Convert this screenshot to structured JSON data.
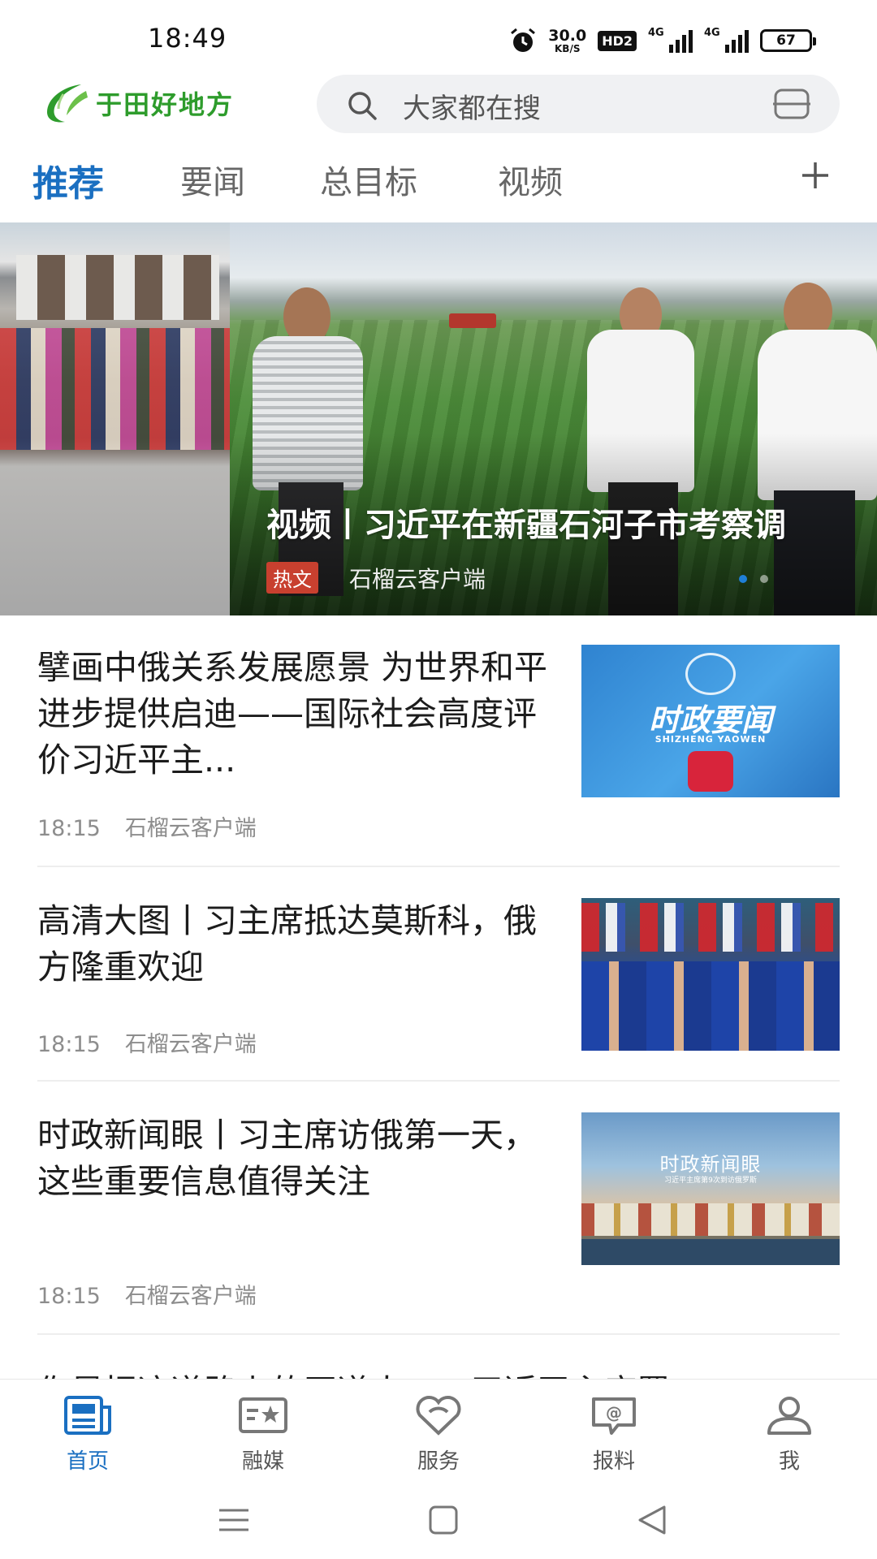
{
  "status_bar": {
    "time": "18:49",
    "speed_value": "30.0",
    "speed_unit": "KB/S",
    "hd_badge": "HD2",
    "network_1": "4G",
    "network_2": "4G",
    "battery": "67"
  },
  "header": {
    "app_name": "于田好地方",
    "search_placeholder": "大家都在搜"
  },
  "tabs": [
    {
      "label": "推荐",
      "active": true
    },
    {
      "label": "要闻",
      "active": false
    },
    {
      "label": "总目标",
      "active": false
    },
    {
      "label": "视频",
      "active": false
    }
  ],
  "banner": {
    "title": "视频丨习近平在新疆石河子市考察调",
    "tag": "热文",
    "source": "石榴云客户端",
    "slide_count": 2,
    "active_slide": 0
  },
  "news": [
    {
      "title": "擘画中俄关系发展愿景 为世界和平进步提供启迪——国际社会高度评价习近平主...",
      "time": "18:15",
      "source": "石榴云客户端",
      "thumb_text_1": "时政要闻",
      "thumb_text_2": "SHIZHENG YAOWEN"
    },
    {
      "title": "高清大图丨习主席抵达莫斯科，俄方隆重欢迎",
      "time": "18:15",
      "source": "石榴云客户端"
    },
    {
      "title": "时政新闻眼丨习主席访俄第一天，这些重要信息值得关注",
      "time": "18:15",
      "source": "石榴云客户端",
      "thumb_text_1": "时政新闻眼",
      "thumb_text_2": "习近平主席第9次到访俄罗斯"
    }
  ],
  "partial_next_title": "‌你是把这道路上的开道人——习近平主席署",
  "bottom_nav": [
    {
      "label": "首页",
      "icon": "home-news-icon",
      "active": true
    },
    {
      "label": "融媒",
      "icon": "media-card-icon",
      "active": false
    },
    {
      "label": "服务",
      "icon": "service-heart-icon",
      "active": false
    },
    {
      "label": "报料",
      "icon": "report-chat-icon",
      "active": false
    },
    {
      "label": "我",
      "icon": "user-icon",
      "active": false
    }
  ],
  "colors": {
    "accent": "#1a6fc1",
    "brand_green": "#2e9c2c",
    "hot_tag": "#c8402f"
  }
}
